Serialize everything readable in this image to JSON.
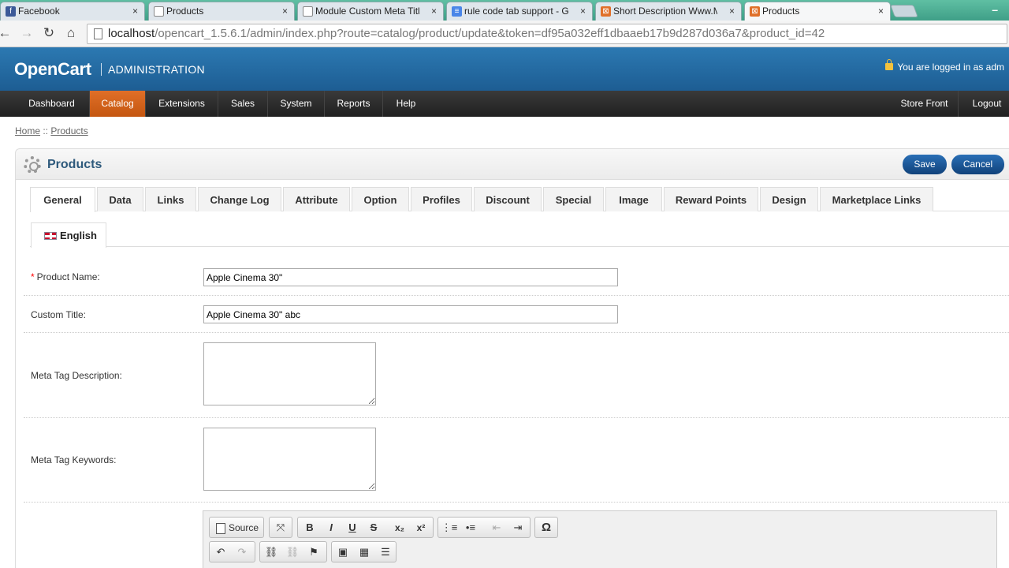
{
  "browser": {
    "tabs": [
      {
        "label": "Facebook",
        "icon": "facebook-icon",
        "icon_color": "#3b5998"
      },
      {
        "label": "Products",
        "icon": "page-icon",
        "icon_color": "#ffffff"
      },
      {
        "label": "Module Custom Meta Titl",
        "icon": "page-icon",
        "icon_color": "#ffffff"
      },
      {
        "label": "rule code tab support - Gc",
        "icon": "docs-icon",
        "icon_color": "#4a86e8"
      },
      {
        "label": "Short Description Www.M",
        "icon": "opencart-icon",
        "icon_color": "#e0702a"
      },
      {
        "label": "Products",
        "icon": "opencart-icon",
        "icon_color": "#e0702a"
      }
    ],
    "url_host": "localhost",
    "url_path": "/opencart_1.5.6.1/admin/index.php?route=catalog/product/update&token=df95a032eff1dbaaeb17b9d287d036a7&product_id=42"
  },
  "header": {
    "logo": "OpenCart",
    "subtitle": "ADMINISTRATION",
    "login_text": "You are logged in as adm"
  },
  "menu": {
    "left": [
      "Dashboard",
      "Catalog",
      "Extensions",
      "Sales",
      "System",
      "Reports",
      "Help"
    ],
    "right": [
      "Store Front",
      "Logout"
    ],
    "active": "Catalog"
  },
  "breadcrumb": {
    "home": "Home",
    "sep": " :: ",
    "current": "Products"
  },
  "box": {
    "title": "Products",
    "save_label": "Save",
    "cancel_label": "Cancel"
  },
  "tabs": [
    "General",
    "Data",
    "Links",
    "Change Log",
    "Attribute",
    "Option",
    "Profiles",
    "Discount",
    "Special",
    "Image",
    "Reward Points",
    "Design",
    "Marketplace Links"
  ],
  "language_tab": "English",
  "form": {
    "product_name_label": "Product Name:",
    "product_name_required": "*",
    "product_name_value": "Apple Cinema 30\"",
    "custom_title_label": "Custom Title:",
    "custom_title_value": "Apple Cinema 30\" abc",
    "meta_description_label": "Meta Tag Description:",
    "meta_keywords_label": "Meta Tag Keywords:"
  },
  "editor": {
    "source_label": "Source"
  }
}
